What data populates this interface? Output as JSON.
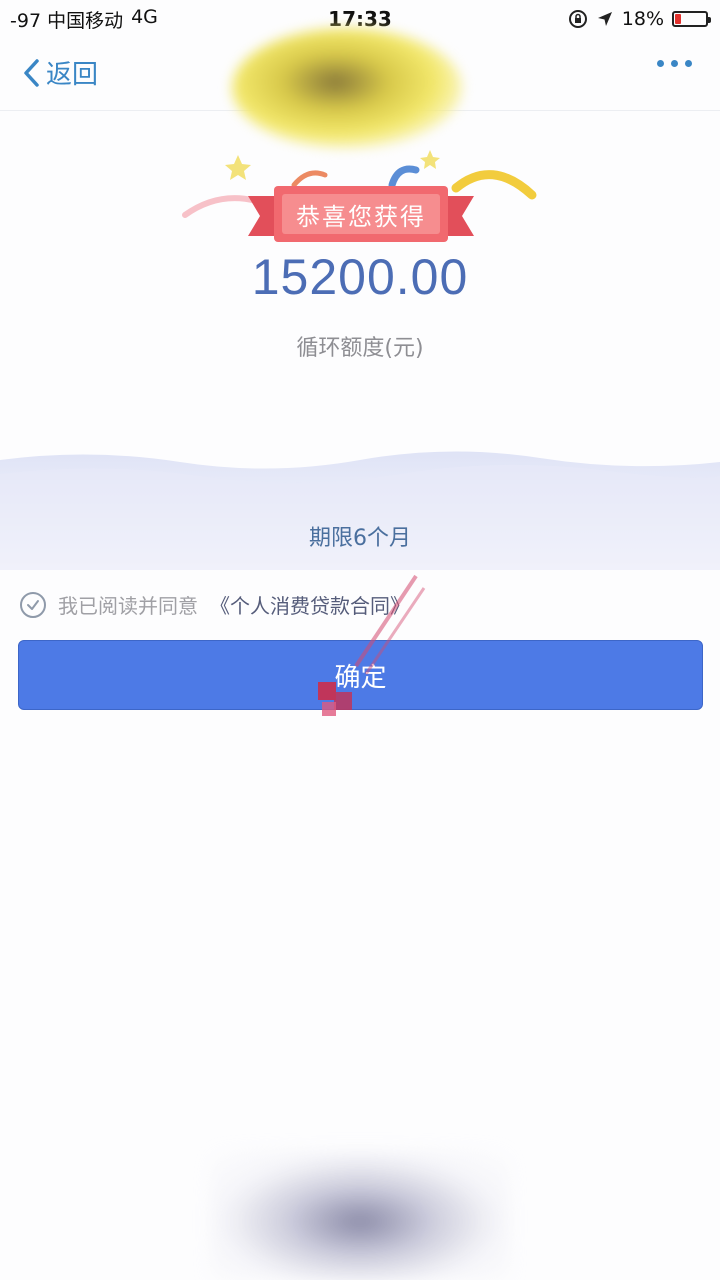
{
  "status_bar": {
    "carrier": "-97 中国移动",
    "network": "4G",
    "time": "17:33",
    "battery": "18%",
    "battery_level": 0.18
  },
  "nav": {
    "back_label": "返回",
    "back_icon": "chevron-left-icon",
    "more_icon": "more-dots-icon"
  },
  "banner": {
    "ribbon_text": "恭喜您获得",
    "amount": "15200.00",
    "amount_label": "循环额度(元)"
  },
  "term": "期限6个月",
  "agreement": {
    "prefix": "我已阅读并同意",
    "contract": "《个人消费贷款合同》"
  },
  "confirm_label": "确定",
  "colors": {
    "accent": "#3a86c5",
    "button": "#4d7ae6",
    "amount": "#4c6db5",
    "ribbon": "#f1696f"
  }
}
